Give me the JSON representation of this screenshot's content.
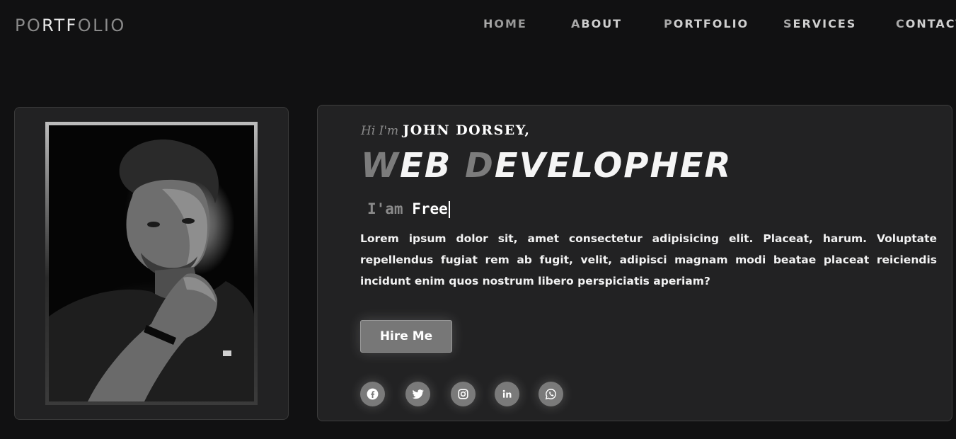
{
  "header": {
    "logo": {
      "part1": "PO",
      "part2": "RTF",
      "part3": "OLIO"
    },
    "nav": [
      {
        "first": "H",
        "rest": "OME"
      },
      {
        "first": "A",
        "rest": "BOUT"
      },
      {
        "first": "P",
        "rest": "ORTFOLIO"
      },
      {
        "first": "S",
        "rest": "ERVICES"
      },
      {
        "first": "C",
        "rest": "ONTACT"
      }
    ]
  },
  "hero": {
    "greeting": "Hi I'm",
    "name": "JOHN DORSEY,",
    "role_w": "W",
    "role_eb": "EB ",
    "role_d": "D",
    "role_rest": "EVELOPHER",
    "typed_prefix": "I'am",
    "typed_word": "Free",
    "description": "Lorem ipsum dolor sit, amet consectetur adipisicing elit. Placeat, harum. Voluptate repellendus fugiat rem ab fugit, velit, adipisci magnam modi beatae placeat reiciendis incidunt enim quos nostrum libero perspiciatis aperiam?",
    "hire_button": "Hire Me"
  },
  "social": [
    "facebook-icon",
    "twitter-icon",
    "instagram-icon",
    "linkedin-icon",
    "whatsapp-icon"
  ],
  "colors": {
    "background": "#111112",
    "card": "#222223",
    "accent_gray": "#7a7a7a",
    "text": "#ffffff"
  }
}
